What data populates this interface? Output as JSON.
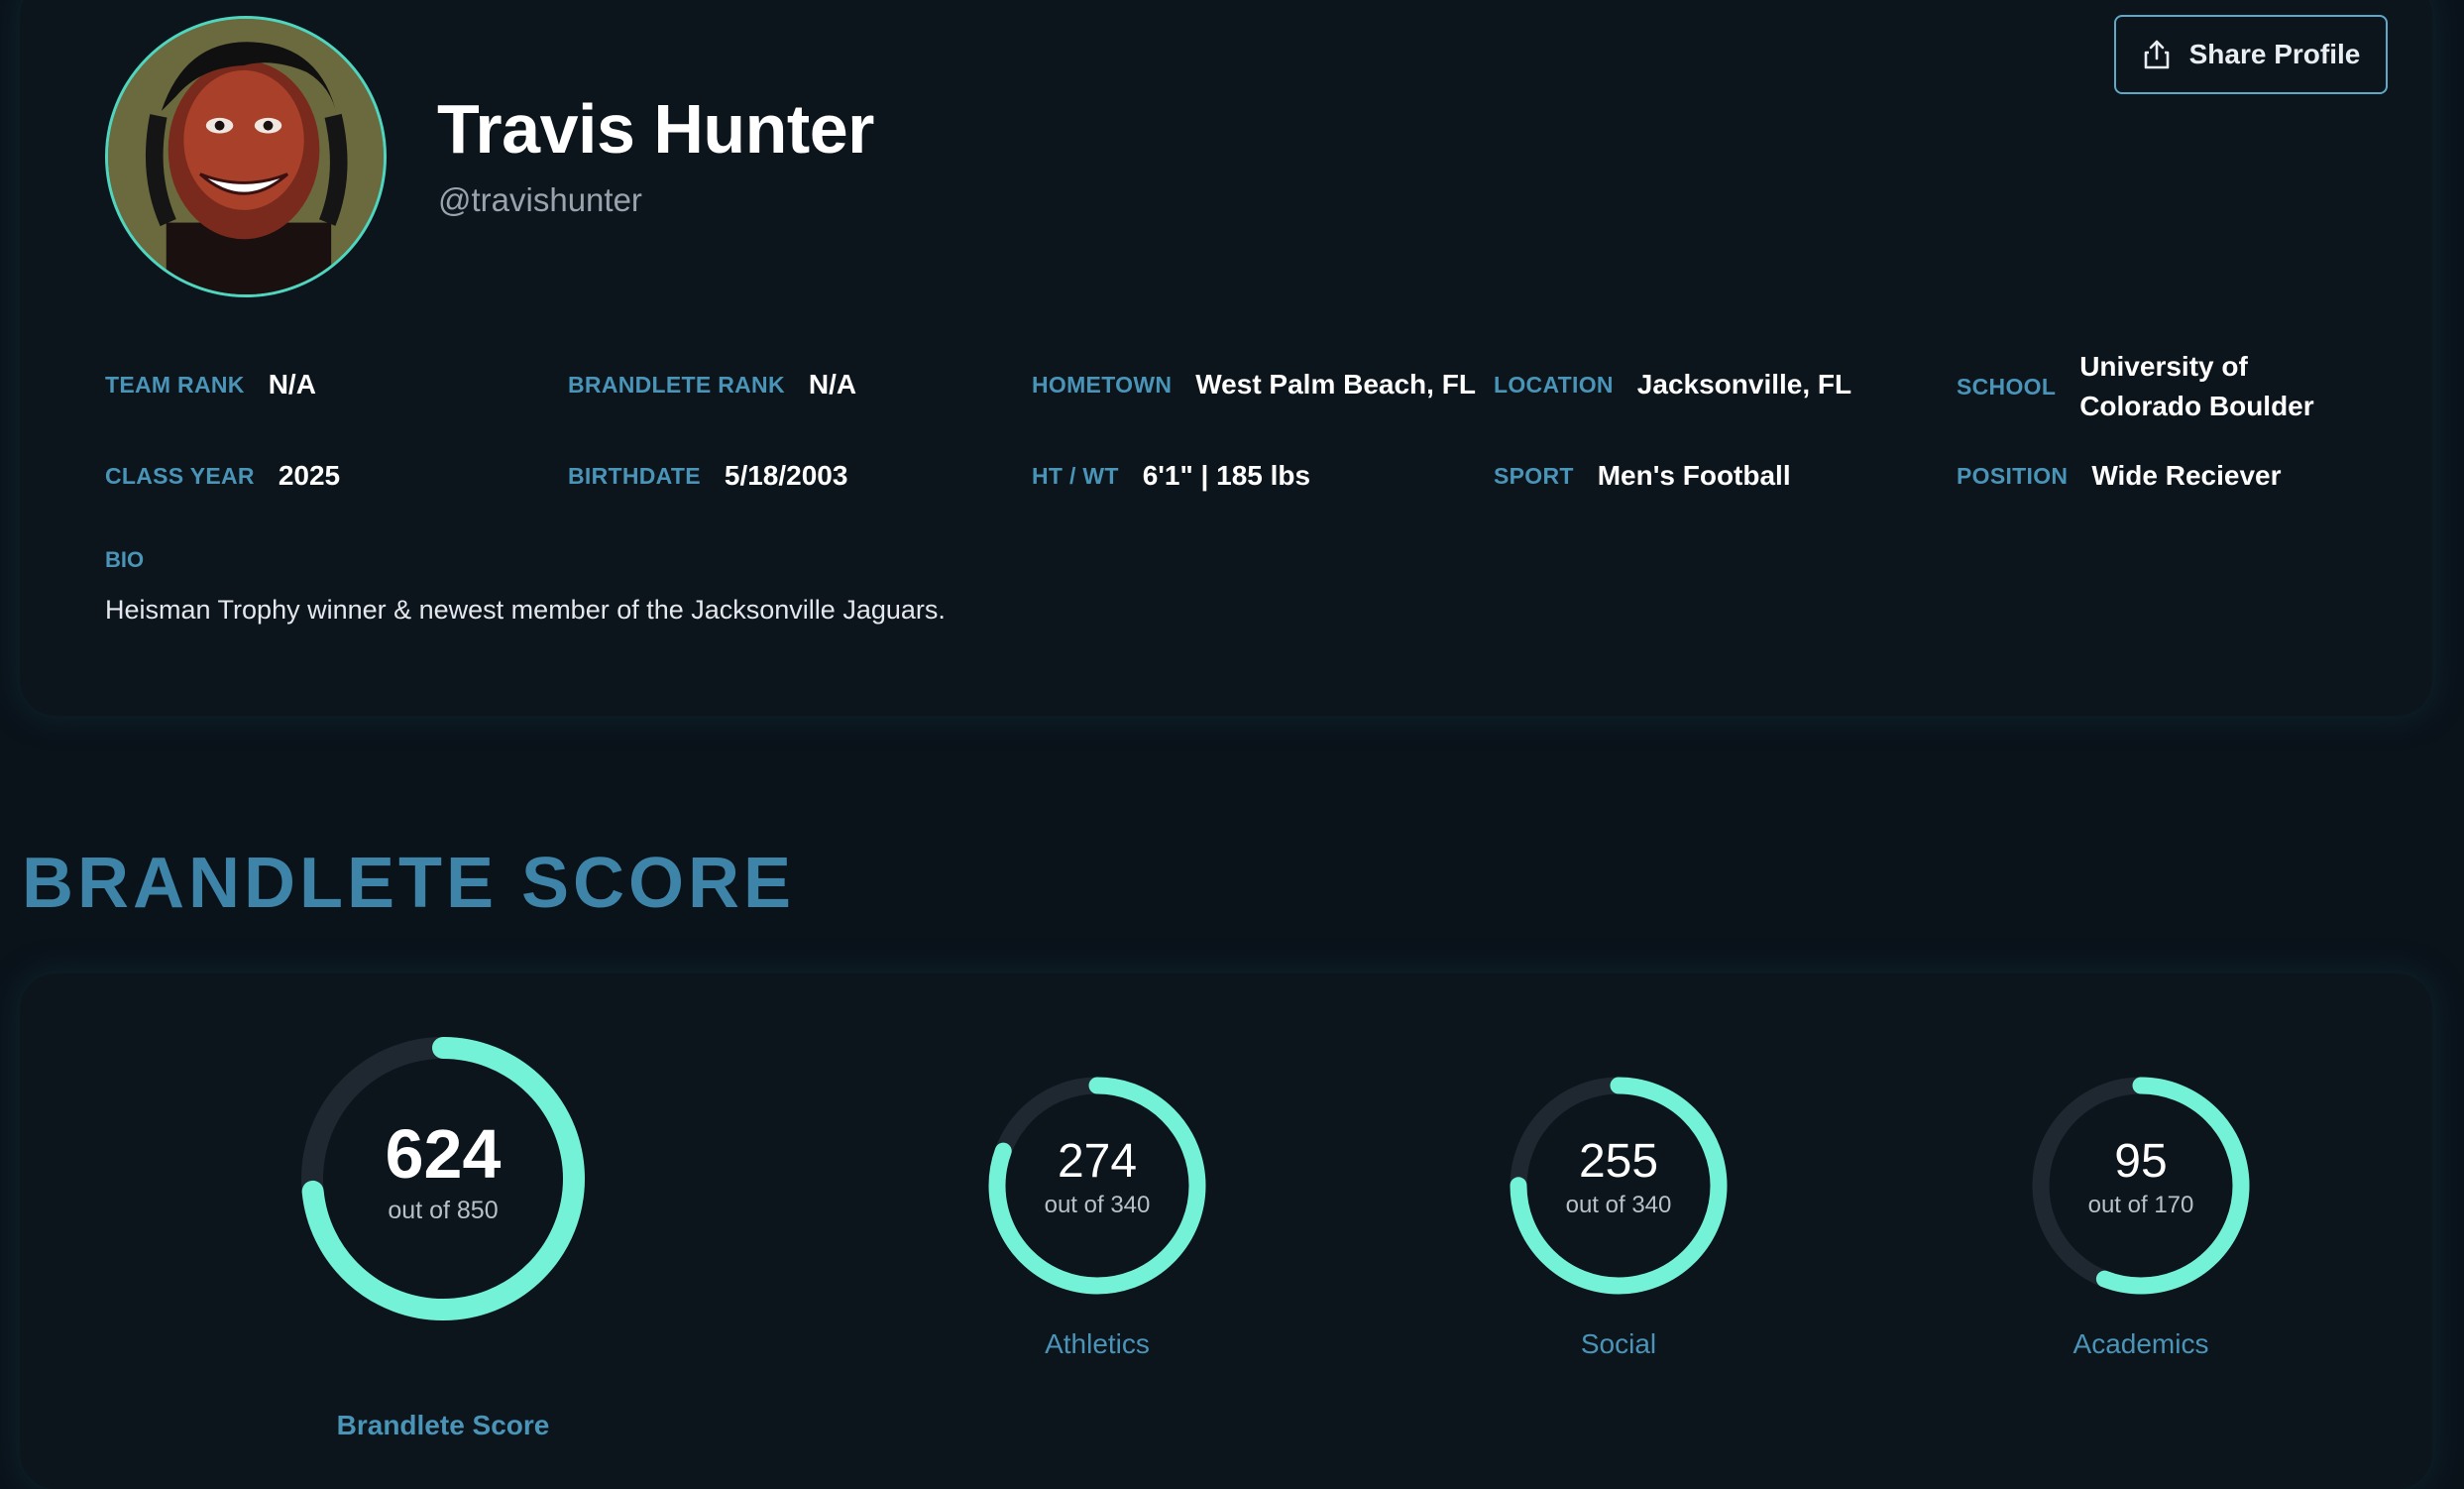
{
  "profile": {
    "name": "Travis Hunter",
    "handle": "@travishunter",
    "share_label": "Share Profile",
    "fields": {
      "team_rank": {
        "label": "TEAM RANK",
        "value": "N/A"
      },
      "brandlete_rank": {
        "label": "BRANDLETE RANK",
        "value": "N/A"
      },
      "hometown": {
        "label": "HOMETOWN",
        "value": "West Palm Beach, FL"
      },
      "location": {
        "label": "LOCATION",
        "value": "Jacksonville, FL"
      },
      "school": {
        "label": "SCHOOL",
        "value": "University of Colorado Boulder"
      },
      "class_year": {
        "label": "CLASS YEAR",
        "value": "2025"
      },
      "birthdate": {
        "label": "BIRTHDATE",
        "value": "5/18/2003"
      },
      "ht_wt": {
        "label": "HT / WT",
        "value": "6'1\" | 185 lbs"
      },
      "sport": {
        "label": "SPORT",
        "value": "Men's Football"
      },
      "position": {
        "label": "POSITION",
        "value": "Wide Reciever"
      }
    },
    "bio": {
      "label": "BIO",
      "text": "Heisman Trophy winner & newest member of the Jacksonville Jaguars."
    }
  },
  "brandlete_score": {
    "title": "BRANDLETE SCORE",
    "gauges": [
      {
        "name": "main-score",
        "value": 624,
        "max": 850,
        "out_of": "out of 850",
        "caption": "Brandlete Score"
      },
      {
        "name": "athletics",
        "value": 274,
        "max": 340,
        "out_of": "out of 340",
        "caption": "Athletics"
      },
      {
        "name": "social",
        "value": 255,
        "max": 340,
        "out_of": "out of 340",
        "caption": "Social"
      },
      {
        "name": "academics",
        "value": 95,
        "max": 170,
        "out_of": "out of 170",
        "caption": "Academics"
      }
    ]
  },
  "colors": {
    "background": "#0a121a",
    "card": "#0c141c",
    "accent_teal": "#73f2d8",
    "track": "#1f2830",
    "label_blue": "#4a94b8",
    "title_blue": "#3e84a8"
  },
  "icons": {
    "share": "share-upload-icon"
  }
}
